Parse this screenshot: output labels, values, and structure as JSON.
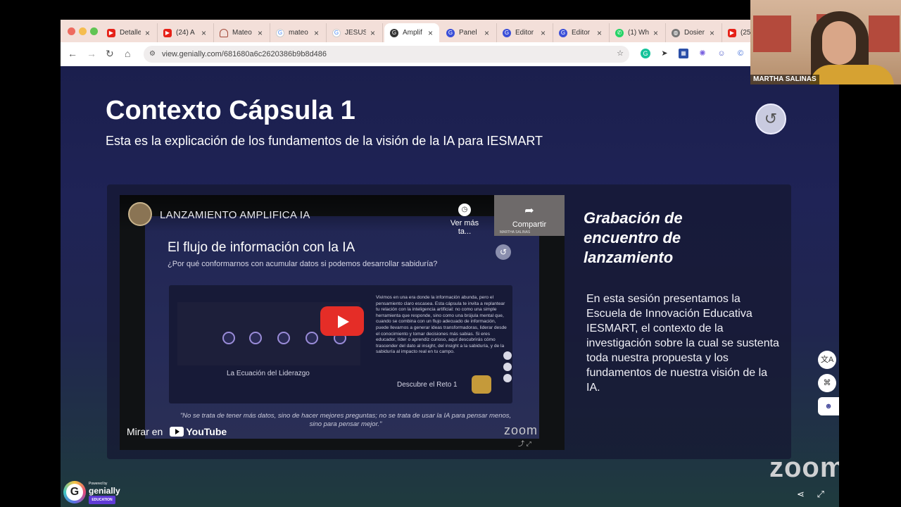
{
  "browser": {
    "tabs": [
      {
        "label": "Detalle",
        "icon": "youtube-icon",
        "color": "#e62117"
      },
      {
        "label": "(24) A",
        "icon": "youtube-icon",
        "color": "#e62117"
      },
      {
        "label": "Mateo",
        "icon": "headset-icon",
        "color": "#a34a3a"
      },
      {
        "label": "mateo",
        "icon": "google-icon",
        "color": "#4285f4"
      },
      {
        "label": "JESUS",
        "icon": "google-icon",
        "color": "#4285f4"
      },
      {
        "label": "Amplif",
        "icon": "genially-icon",
        "color": "#333333"
      },
      {
        "label": "Panel",
        "icon": "genially-icon",
        "color": "#3b4fd8"
      },
      {
        "label": "Editor",
        "icon": "genially-icon",
        "color": "#3b4fd8"
      },
      {
        "label": "Editor",
        "icon": "genially-icon",
        "color": "#3b4fd8"
      },
      {
        "label": "(1) Wh",
        "icon": "whatsapp-icon",
        "color": "#25d366"
      },
      {
        "label": "Dosier",
        "icon": "globe-icon",
        "color": "#777777"
      },
      {
        "label": "(25)",
        "icon": "youtube-icon",
        "color": "#e62117"
      }
    ],
    "active_tab": 5,
    "url": "view.genially.com/681680a6c2620386b9b8d486"
  },
  "slide": {
    "title": "Contexto Cápsula 1",
    "subtitle": "Esta es la explicación de los fundamentos de la visión de la IA para IESMART",
    "recording_title": "Grabación de encuentro de lanzamiento",
    "recording_description": "En esta sesión presentamos la Escuela de Innovación Educativa IESMART, el contexto de la investigación sobre la cual se sustenta toda nuestra propuesta y los fundamentos de nuestra visión de la IA."
  },
  "video": {
    "title": "LANZAMIENTO AMPLIFICA IA",
    "watch_later": "Ver más ta...",
    "share": "Compartir",
    "thumb_name": "MARTHA SALINAS",
    "watch_on": "Mirar en",
    "youtube": "YouTube",
    "zoom_watermark": "zoom",
    "inner": {
      "title": "El flujo de información con la IA",
      "subtitle": "¿Por qué conformarnos con acumular datos si podemos desarrollar sabiduría?",
      "paragraph": "Vivimos en una era donde la información abunda, pero el pensamiento claro escasea. Esta cápsula te invita a replantear tu relación con la inteligencia artificial: no como una simple herramienta que responde, sino como una brújula mental que, cuando se combina con un flujo adecuado de información, puede llevarnos a generar ideas transformadoras, liderar desde el conocimiento y tomar decisiones más sabias. Si eres educador, líder o aprendiz curioso, aquí descubrirás cómo trascender del dato al insight, del insight a la sabiduría, y de la sabiduría al impacto real en tu campo.",
      "equation_label": "La Ecuación del Liderazgo",
      "reto_label": "Descubre el Reto 1",
      "quote": "\"No se trata de tener más datos, sino de hacer mejores preguntas; no se trata de usar la IA para pensar menos, sino para pensar mejor.\""
    }
  },
  "overlays": {
    "zoom_watermark": "zoom",
    "genially_powered": "Powered by",
    "genially_name": "genially",
    "genially_edu": "EDUCATION",
    "webcam_name": "MARTHA SALINAS"
  },
  "colors": {
    "slide_bg": "#1f2356",
    "youtube_red": "#e52d27",
    "genially_purple": "#5f3bd6"
  }
}
